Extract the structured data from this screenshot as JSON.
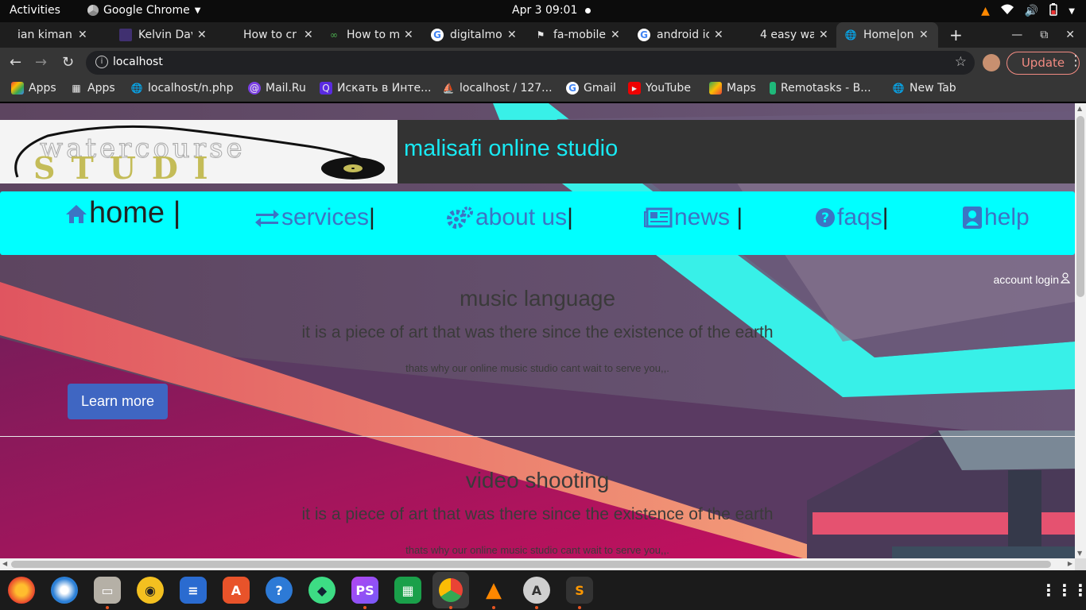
{
  "system_bar": {
    "activities": "Activities",
    "app_name": "Google Chrome",
    "clock": "Apr 3  09:01"
  },
  "tabs": [
    {
      "title": "ian kiman",
      "icon": "blank-icon"
    },
    {
      "title": "Kelvin Dav",
      "icon": "image-icon"
    },
    {
      "title": "How to cr",
      "icon": "blank-icon"
    },
    {
      "title": "How to m",
      "icon": "infinity-icon"
    },
    {
      "title": "digitalmo",
      "icon": "google-icon"
    },
    {
      "title": "fa-mobile",
      "icon": "flag-icon"
    },
    {
      "title": "android ic",
      "icon": "google-icon"
    },
    {
      "title": "4 easy wa",
      "icon": "blank-icon"
    },
    {
      "title": "Home|onl",
      "icon": "globe-icon",
      "active": true
    }
  ],
  "toolbar": {
    "url": "localhost",
    "update_label": "Update"
  },
  "bookmarks": [
    {
      "label": "Apps",
      "icon": "apps-grid-icon"
    },
    {
      "label": "Apps",
      "icon": "apps-grid-icon"
    },
    {
      "label": "localhost/n.php",
      "icon": "globe-icon"
    },
    {
      "label": "Mail.Ru",
      "icon": "mailru-icon"
    },
    {
      "label": "Искать в Инте...",
      "icon": "search-icon"
    },
    {
      "label": "localhost / 127...",
      "icon": "phpmyadmin-icon"
    },
    {
      "label": "Gmail",
      "icon": "google-icon"
    },
    {
      "label": "YouTube",
      "icon": "youtube-icon"
    },
    {
      "label": "Maps",
      "icon": "maps-icon"
    },
    {
      "label": "Remotasks - B...",
      "icon": "remotasks-icon"
    },
    {
      "label": "New Tab",
      "icon": "globe-icon"
    }
  ],
  "site": {
    "logo_top_text": "watercourse",
    "logo_main_text": "STUDI",
    "title": "malisafi online studio",
    "nav": [
      {
        "label": "home",
        "icon": "home-icon"
      },
      {
        "label": "services",
        "icon": "exchange-icon"
      },
      {
        "label": "about us",
        "icon": "cogs-icon"
      },
      {
        "label": "news",
        "icon": "newspaper-icon"
      },
      {
        "label": "faqs",
        "icon": "question-circle-icon"
      },
      {
        "label": "help",
        "icon": "user-box-icon"
      }
    ],
    "account_login": "account login",
    "sections": [
      {
        "heading": "music language",
        "subheading": "it is a piece of art that was there since the existence of the earth",
        "tagline": "thats why our online music studio cant wait to serve you,,.",
        "button": "Learn more"
      },
      {
        "heading": "video shooting",
        "subheading": "it is a piece of art that was there since the existence of the earth",
        "tagline": "thats why our online music studio cant wait to serve you,,."
      }
    ]
  },
  "colors": {
    "nav_bg": "#00ffff",
    "title_color": "#18e9f3",
    "button_bg": "#3f66c2",
    "update_accent": "#f28b82"
  },
  "dock": [
    {
      "name": "firefox-icon"
    },
    {
      "name": "thunderbird-icon"
    },
    {
      "name": "files-icon"
    },
    {
      "name": "rhythmbox-icon"
    },
    {
      "name": "libreoffice-writer-icon"
    },
    {
      "name": "software-center-icon"
    },
    {
      "name": "help-icon"
    },
    {
      "name": "android-studio-icon"
    },
    {
      "name": "phpstorm-icon"
    },
    {
      "name": "libreoffice-calc-icon"
    },
    {
      "name": "chrome-icon"
    },
    {
      "name": "vlc-icon"
    },
    {
      "name": "software-updater-icon"
    },
    {
      "name": "sublime-text-icon"
    },
    {
      "name": "show-apps-icon"
    }
  ]
}
